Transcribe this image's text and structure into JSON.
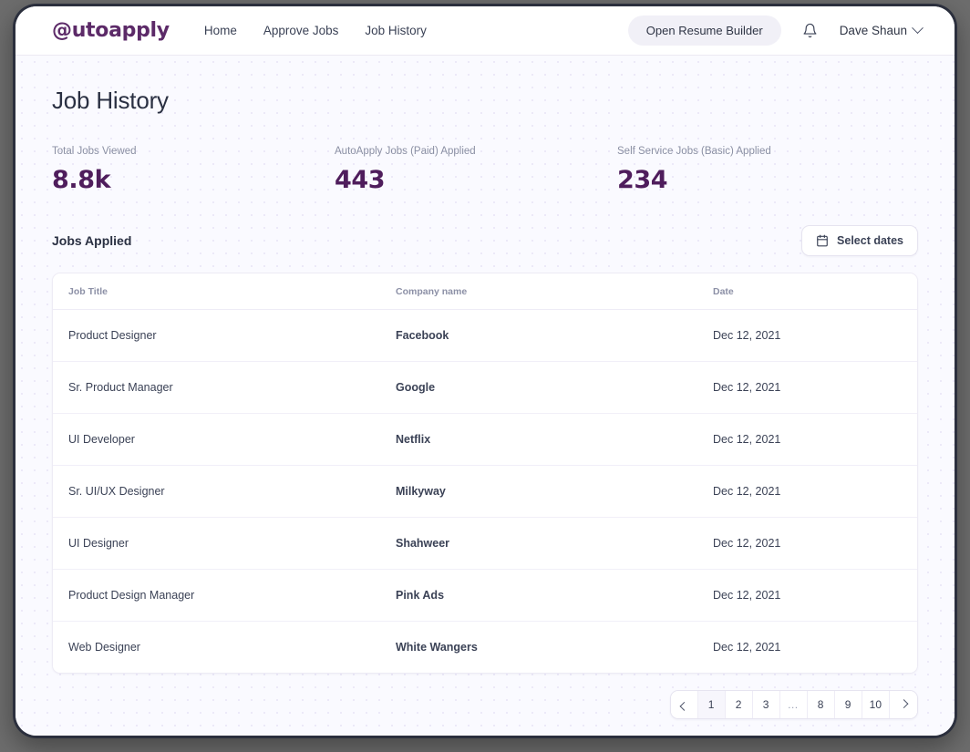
{
  "nav": {
    "logo": "@utoapply",
    "links": [
      {
        "label": "Home"
      },
      {
        "label": "Approve Jobs"
      },
      {
        "label": "Job History"
      }
    ],
    "resume_button": "Open Resume Builder",
    "bell_icon": "bell-icon",
    "user_name": "Dave Shaun",
    "user_chevron_icon": "chevron-down-icon"
  },
  "page": {
    "title": "Job History"
  },
  "stats": [
    {
      "label": "Total Jobs Viewed",
      "value": "8.8k"
    },
    {
      "label": "AutoApply Jobs (Paid) Applied",
      "value": "443"
    },
    {
      "label": "Self Service Jobs (Basic) Applied",
      "value": "234"
    }
  ],
  "section": {
    "title": "Jobs Applied",
    "select_dates_label": "Select dates",
    "calendar_icon": "calendar-icon"
  },
  "table": {
    "columns": [
      "Job Title",
      "Company name",
      "Date"
    ],
    "rows": [
      {
        "title": "Product Designer",
        "company": "Facebook",
        "date": "Dec 12, 2021"
      },
      {
        "title": "Sr. Product Manager",
        "company": "Google",
        "date": "Dec 12, 2021"
      },
      {
        "title": "UI Developer",
        "company": "Netflix",
        "date": "Dec 12, 2021"
      },
      {
        "title": "Sr. UI/UX Designer",
        "company": "Milkyway",
        "date": "Dec 12, 2021"
      },
      {
        "title": "UI Designer",
        "company": "Shahweer",
        "date": "Dec 12, 2021"
      },
      {
        "title": "Product Design Manager",
        "company": "Pink Ads",
        "date": "Dec 12, 2021"
      },
      {
        "title": "Web Designer",
        "company": "White Wangers",
        "date": "Dec 12, 2021"
      }
    ]
  },
  "pagination": {
    "prev_icon": "chevron-left-icon",
    "next_icon": "chevron-right-icon",
    "pages": [
      "1",
      "2",
      "3",
      "…",
      "8",
      "9",
      "10"
    ],
    "active_page": "1"
  },
  "colors": {
    "brand_purple": "#5c2a68",
    "stat_value": "#4f1d5c",
    "text_primary": "#2a3042",
    "text_muted": "#8a8fa3",
    "canvas": "#fafaff",
    "frame": "#2b2f3d"
  }
}
